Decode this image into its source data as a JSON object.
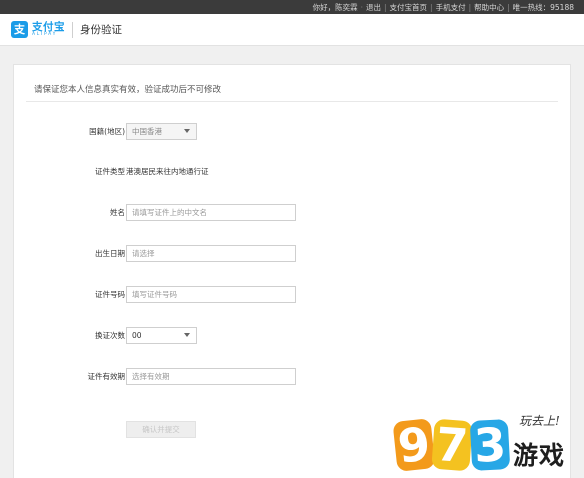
{
  "topbar": {
    "greeting": "你好，陈奕霖",
    "dot": "·",
    "logout": "退出",
    "links": [
      "支付宝首页",
      "手机支付",
      "帮助中心"
    ],
    "hotline": "唯一热线：95188"
  },
  "header": {
    "logo_mark": "支",
    "logo_cn": "支付宝",
    "logo_en": "ALIPAY",
    "title": "身份验证"
  },
  "notice": "请保证您本人信息真实有效，验证成功后不可修改",
  "form": {
    "nationality_label": "国籍(地区)",
    "nationality_value": "中国香港",
    "id_type_label": "证件类型",
    "id_type_value": "港澳居民来往内地通行证",
    "name_label": "姓名",
    "name_placeholder": "请填写证件上的中文名",
    "dob_label": "出生日期",
    "dob_placeholder": "请选择",
    "id_number_label": "证件号码",
    "id_number_placeholder": "填写证件号码",
    "renewals_label": "换证次数",
    "renewals_value": "00",
    "validity_label": "证件有效期",
    "validity_placeholder": "选择有效期",
    "submit_label": "确认并提交"
  },
  "watermark": {
    "digits": [
      "9",
      "7",
      "3"
    ],
    "slogan": "玩去上!",
    "name": "游戏"
  },
  "colors": {
    "brand_blue": "#1a9ce8",
    "topbar_bg": "#3b3b3b"
  }
}
